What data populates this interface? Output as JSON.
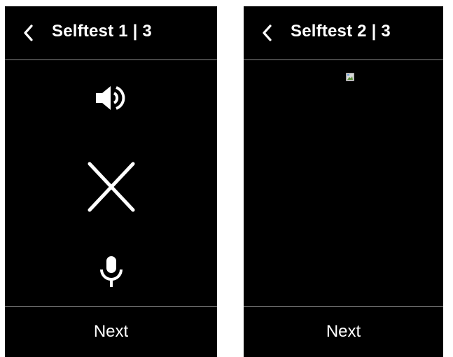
{
  "screens": [
    {
      "title": "Selftest 1 | 3",
      "back_icon": "chevron-left-icon",
      "content_icons": [
        "speaker-icon",
        "close-icon",
        "microphone-icon"
      ],
      "next_label": "Next"
    },
    {
      "title": "Selftest 2 | 3",
      "back_icon": "chevron-left-icon",
      "content_icons": [
        "broken-image-icon"
      ],
      "next_label": "Next"
    }
  ],
  "colors": {
    "screen_background": "#000000",
    "text": "#ffffff",
    "divider": "#8a8a8a",
    "page_background": "#ffffff"
  }
}
